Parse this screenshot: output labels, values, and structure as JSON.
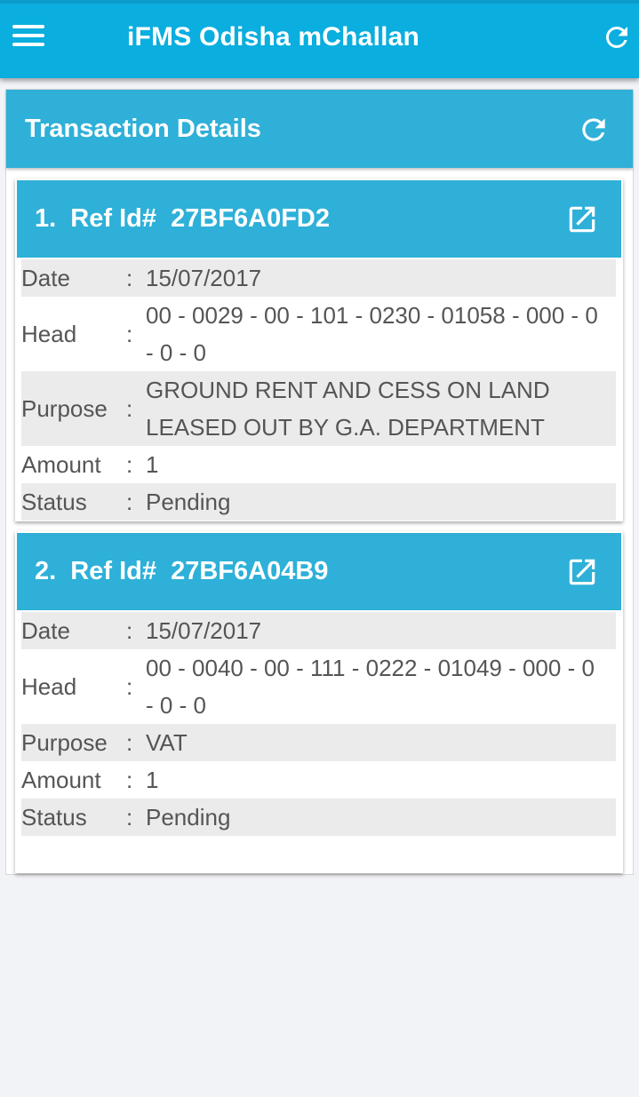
{
  "app": {
    "title": "iFMS Odisha mChallan"
  },
  "section": {
    "title": "Transaction Details"
  },
  "labels": {
    "date": "Date",
    "head": "Head",
    "purpose": "Purpose",
    "amount": "Amount",
    "status": "Status",
    "separator": ":"
  },
  "transactions": [
    {
      "title": "1.  Ref Id#  27BF6A0FD2",
      "date": "15/07/2017",
      "head_line1": "00 - 0029 - 00 - 101 - 0230 - 01058 - 000 - 0",
      "head_line2": "- 0 - 0",
      "purpose_line1": "GROUND RENT AND CESS ON LAND",
      "purpose_line2": "LEASED OUT BY G.A. DEPARTMENT",
      "amount": "1",
      "status": "Pending"
    },
    {
      "title": "2.  Ref Id#  27BF6A04B9",
      "date": "15/07/2017",
      "head_line1": "00 - 0040 - 00 - 111 - 0222 - 01049 - 000 - 0",
      "head_line2": "- 0 - 0",
      "purpose_line1": "VAT",
      "amount": "1",
      "status": "Pending"
    }
  ],
  "icons": {
    "menu": "hamburger-menu-icon",
    "refresh": "refresh-icon",
    "open": "open-external-icon"
  },
  "colors": {
    "topbar": "#0aaedf",
    "header": "#2eb0d8",
    "row_shade": "#ebebeb",
    "text": "#555555",
    "background": "#f2f3f7"
  }
}
